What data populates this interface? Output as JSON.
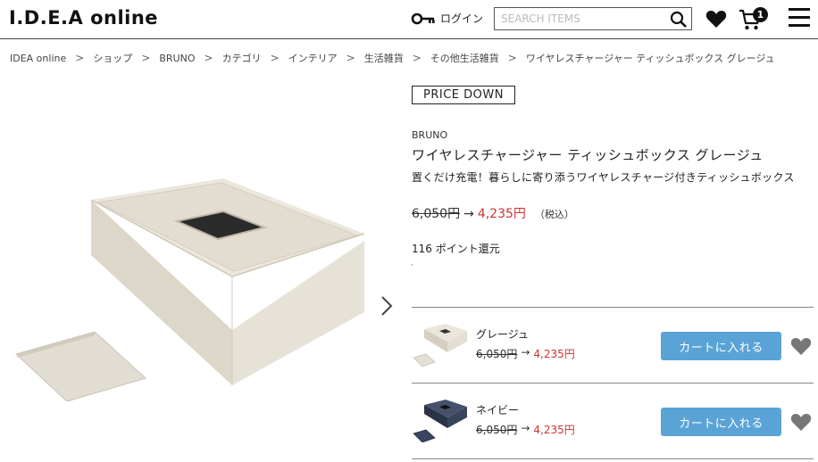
{
  "header": {
    "logo": "I.D.E.A online",
    "login_label": "ログイン",
    "search_placeholder": "SEARCH ITEMS",
    "cart_count": "1"
  },
  "breadcrumb": [
    "IDEA online",
    "ショップ",
    "BRUNO",
    "カテゴリ",
    "インテリア",
    "生活雑貨",
    "その他生活雑貨",
    "ワイヤレスチャージャー ティッシュボックス グレージュ"
  ],
  "product": {
    "badge": "PRICE DOWN",
    "brand": "BRUNO",
    "title": "ワイヤレスチャージャー ティッシュボックス グレージュ",
    "subtitle": "置くだけ充電！暮らしに寄り添うワイヤレスチャージ付きティッシュボックス",
    "old_price": "6,050円",
    "arrow": "→",
    "new_price": "4,235円",
    "tax_label": "（税込）",
    "points": "116 ポイント還元"
  },
  "variants": [
    {
      "name": "グレージュ",
      "old_price": "6,050円",
      "arrow": "→",
      "new_price": "4,235円",
      "button_label": "カートに入れる",
      "color": "#d9d3c6"
    },
    {
      "name": "ネイビー",
      "old_price": "6,050円",
      "arrow": "→",
      "new_price": "4,235円",
      "button_label": "カートに入れる",
      "color": "#2e3a50"
    }
  ],
  "colors": {
    "accent_button": "#5aa3d6",
    "sale_price": "#cc3333",
    "icon_gray": "#777777"
  }
}
